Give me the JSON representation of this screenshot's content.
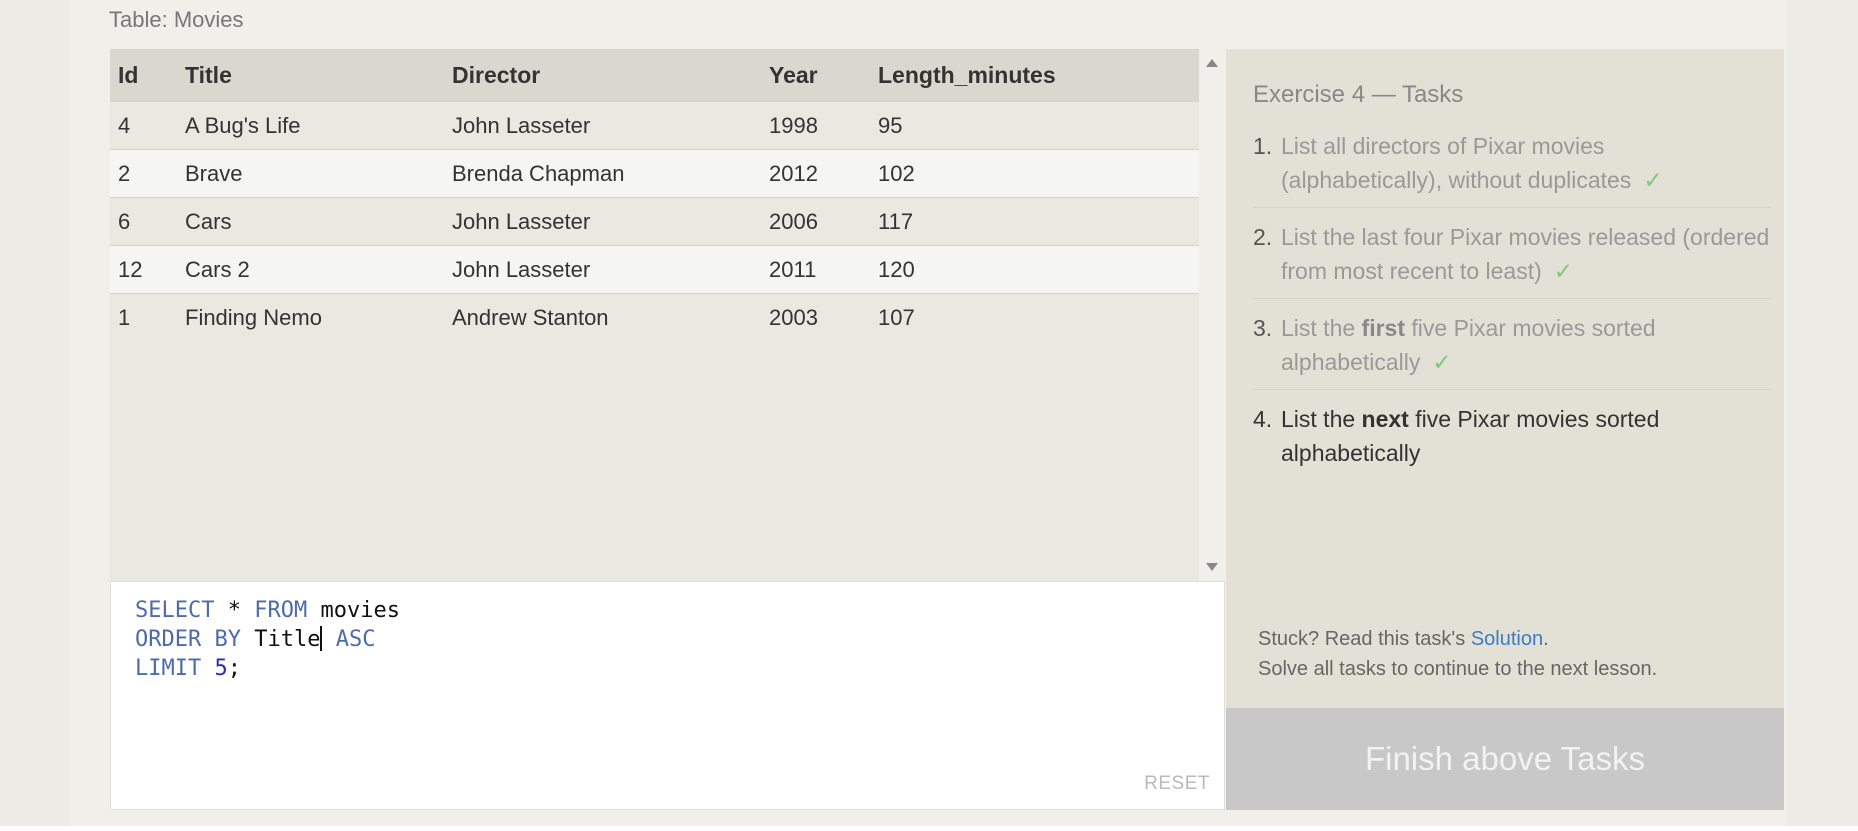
{
  "table": {
    "caption": "Table: Movies",
    "columns": [
      "Id",
      "Title",
      "Director",
      "Year",
      "Length_minutes"
    ],
    "rows": [
      [
        "4",
        "A Bug's Life",
        "John Lasseter",
        "1998",
        "95"
      ],
      [
        "2",
        "Brave",
        "Brenda Chapman",
        "2012",
        "102"
      ],
      [
        "6",
        "Cars",
        "John Lasseter",
        "2006",
        "117"
      ],
      [
        "12",
        "Cars 2",
        "John Lasseter",
        "2011",
        "120"
      ],
      [
        "1",
        "Finding Nemo",
        "Andrew Stanton",
        "2003",
        "107"
      ]
    ]
  },
  "editor": {
    "line1_kw1": "SELECT",
    "line1_star": " * ",
    "line1_kw2": "FROM",
    "line1_rest": " movies",
    "line2_kw1": "ORDER BY",
    "line2_mid": " Title",
    "line2_kw2": " ASC",
    "line3_kw": "LIMIT",
    "line3_num": " 5",
    "line3_end": ";",
    "reset_label": "RESET"
  },
  "tasks": {
    "title": "Exercise 4 — Tasks",
    "items": [
      {
        "num": "1.",
        "text_a": "List all directors of Pixar movies (alphabetically), without duplicates",
        "check": "✓"
      },
      {
        "num": "2.",
        "text_a": "List the last four Pixar movies released (ordered from most recent to least)",
        "check": "✓"
      },
      {
        "num": "3.",
        "pre": "List the ",
        "bold": "first",
        "post": " five Pixar movies sorted alphabetically",
        "check": "✓"
      },
      {
        "num": "4.",
        "pre": "List the ",
        "bold": "next",
        "post": " five Pixar movies sorted alphabetically"
      }
    ],
    "stuck_pre": "Stuck? Read this task's ",
    "solution_link": "Solution",
    "stuck_post": ".",
    "solve_all": "Solve all tasks to continue to the next lesson.",
    "finish_button": "Finish above Tasks"
  },
  "colors": {
    "keyword": "#4e6ba9",
    "number": "#2b2bbf",
    "check": "#7ec77e",
    "link": "#3d7bc6",
    "finish_bg": "#c8c8c8"
  }
}
